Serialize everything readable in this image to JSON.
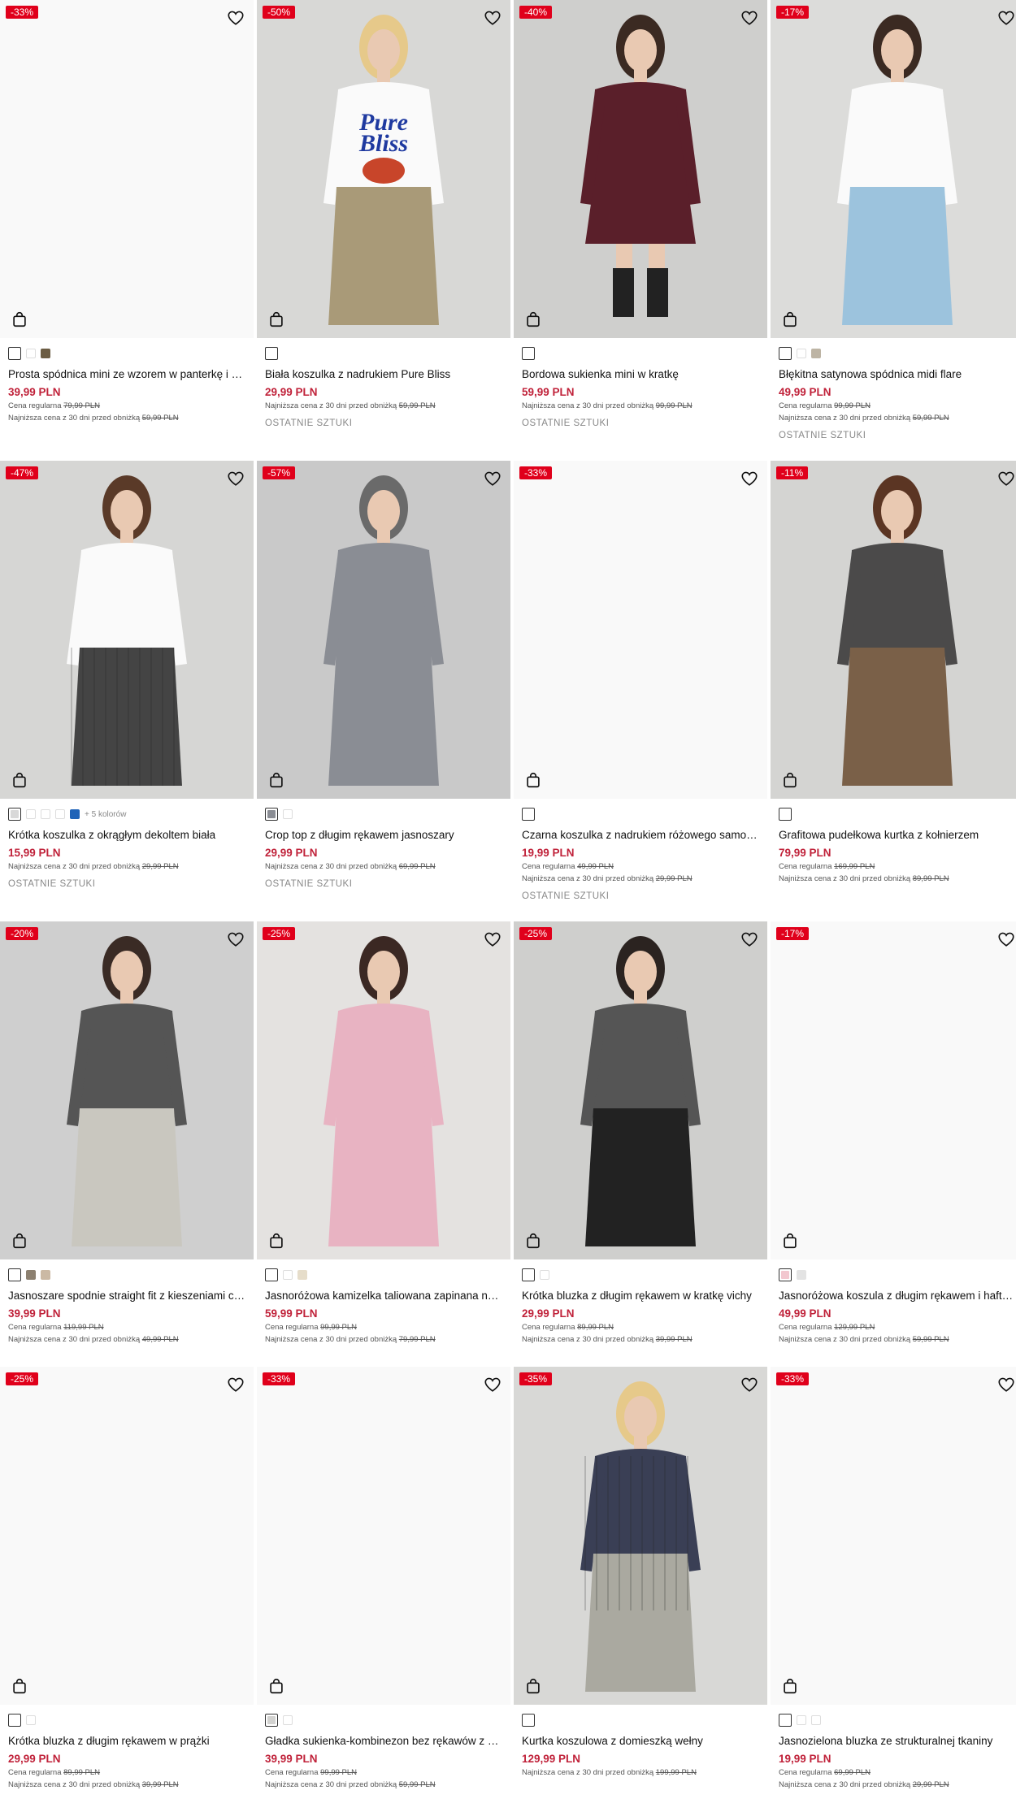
{
  "products": [
    {
      "badge": "-33%",
      "name": "Prosta spódnica mini ze wzorem w panterkę i sztucznym futerkiem",
      "price": "39,99 PLN",
      "regular_label": "Cena regularna",
      "regular": "79,99 PLN",
      "lowest_label": "Najniższa cena z 30 dni przed obniżką",
      "lowest": "59,99 PLN",
      "stock": ""
    },
    {
      "badge": "-50%",
      "name": "Biała koszulka z nadrukiem Pure Bliss",
      "price": "29,99 PLN",
      "regular_label": "",
      "regular": "",
      "lowest_label": "Najniższa cena z 30 dni przed obniżką",
      "lowest": "59,99 PLN",
      "stock": "OSTATNIE SZTUKI",
      "print_line1": "Pure",
      "print_line2": "Bliss"
    },
    {
      "badge": "-40%",
      "name": "Bordowa sukienka mini w kratkę",
      "price": "59,99 PLN",
      "regular_label": "",
      "regular": "",
      "lowest_label": "Najniższa cena z 30 dni przed obniżką",
      "lowest": "99,99 PLN",
      "stock": "OSTATNIE SZTUKI"
    },
    {
      "badge": "-17%",
      "name": "Błękitna satynowa spódnica midi flare",
      "price": "49,99 PLN",
      "regular_label": "Cena regularna",
      "regular": "99,99 PLN",
      "lowest_label": "Najniższa cena z 30 dni przed obniżką",
      "lowest": "59,99 PLN",
      "stock": "OSTATNIE SZTUKI"
    },
    {
      "badge": "-47%",
      "name": "Krótka koszulka z okrągłym dekoltem biała",
      "price": "15,99 PLN",
      "regular_label": "",
      "regular": "",
      "lowest_label": "Najniższa cena z 30 dni przed obniżką",
      "lowest": "29,99 PLN",
      "stock": "OSTATNIE SZTUKI",
      "more_colors": "+ 5 kolorów"
    },
    {
      "badge": "-57%",
      "name": "Crop top z długim rękawem jasnoszary",
      "price": "29,99 PLN",
      "regular_label": "",
      "regular": "",
      "lowest_label": "Najniższa cena z 30 dni przed obniżką",
      "lowest": "69,99 PLN",
      "stock": "OSTATNIE SZTUKI"
    },
    {
      "badge": "-33%",
      "name": "Czarna koszulka z nadrukiem różowego samochodu",
      "price": "19,99 PLN",
      "regular_label": "Cena regularna",
      "regular": "49,99 PLN",
      "lowest_label": "Najniższa cena z 30 dni przed obniżką",
      "lowest": "29,99 PLN",
      "stock": "OSTATNIE SZTUKI"
    },
    {
      "badge": "-11%",
      "name": "Grafitowa pudełkowa kurtka z kołnierzem",
      "price": "79,99 PLN",
      "regular_label": "Cena regularna",
      "regular": "169,99 PLN",
      "lowest_label": "Najniższa cena z 30 dni przed obniżką",
      "lowest": "89,99 PLN",
      "stock": ""
    },
    {
      "badge": "-20%",
      "name": "Jasnoszare spodnie straight fit z kieszeniami cargo",
      "price": "39,99 PLN",
      "regular_label": "Cena regularna",
      "regular": "119,99 PLN",
      "lowest_label": "Najniższa cena z 30 dni przed obniżką",
      "lowest": "49,99 PLN",
      "stock": ""
    },
    {
      "badge": "-25%",
      "name": "Jasnoróżowa kamizelka taliowana zapinana na guziki",
      "price": "59,99 PLN",
      "regular_label": "Cena regularna",
      "regular": "99,99 PLN",
      "lowest_label": "Najniższa cena z 30 dni przed obniżką",
      "lowest": "79,99 PLN",
      "stock": ""
    },
    {
      "badge": "-25%",
      "name": "Krótka bluzka z długim rękawem w kratkę vichy",
      "price": "29,99 PLN",
      "regular_label": "Cena regularna",
      "regular": "89,99 PLN",
      "lowest_label": "Najniższa cena z 30 dni przed obniżką",
      "lowest": "39,99 PLN",
      "stock": ""
    },
    {
      "badge": "-17%",
      "name": "Jasnoróżowa koszula z długim rękawem i haftem",
      "price": "49,99 PLN",
      "regular_label": "Cena regularna",
      "regular": "129,99 PLN",
      "lowest_label": "Najniższa cena z 30 dni przed obniżką",
      "lowest": "59,99 PLN",
      "stock": ""
    },
    {
      "badge": "-25%",
      "name": "Krótka bluzka z długim rękawem w prążki",
      "price": "29,99 PLN",
      "regular_label": "Cena regularna",
      "regular": "89,99 PLN",
      "lowest_label": "Najniższa cena z 30 dni przed obniżką",
      "lowest": "39,99 PLN",
      "stock": ""
    },
    {
      "badge": "-33%",
      "name": "Gładka sukienka-kombinezon bez rękawów z paskiem",
      "price": "39,99 PLN",
      "regular_label": "Cena regularna",
      "regular": "99,99 PLN",
      "lowest_label": "Najniższa cena z 30 dni przed obniżką",
      "lowest": "59,99 PLN",
      "stock": ""
    },
    {
      "badge": "-35%",
      "name": "Kurtka koszulowa z domieszką wełny",
      "price": "129,99 PLN",
      "regular_label": "",
      "regular": "",
      "lowest_label": "Najniższa cena z 30 dni przed obniżką",
      "lowest": "199,99 PLN",
      "stock": ""
    },
    {
      "badge": "-33%",
      "name": "Jasnozielona bluzka ze strukturalnej tkaniny",
      "price": "19,99 PLN",
      "regular_label": "Cena regularna",
      "regular": "69,99 PLN",
      "lowest_label": "Najniższa cena z 30 dni przed obniżką",
      "lowest": "29,99 PLN",
      "stock": ""
    }
  ],
  "colors": {
    "sale_badge": "#e0001b",
    "price": "#c0223a",
    "blank_image": "#f9f9f9"
  },
  "icons": {
    "wishlist": "heart-icon",
    "add_to_cart": "shopping-bag-icon"
  }
}
